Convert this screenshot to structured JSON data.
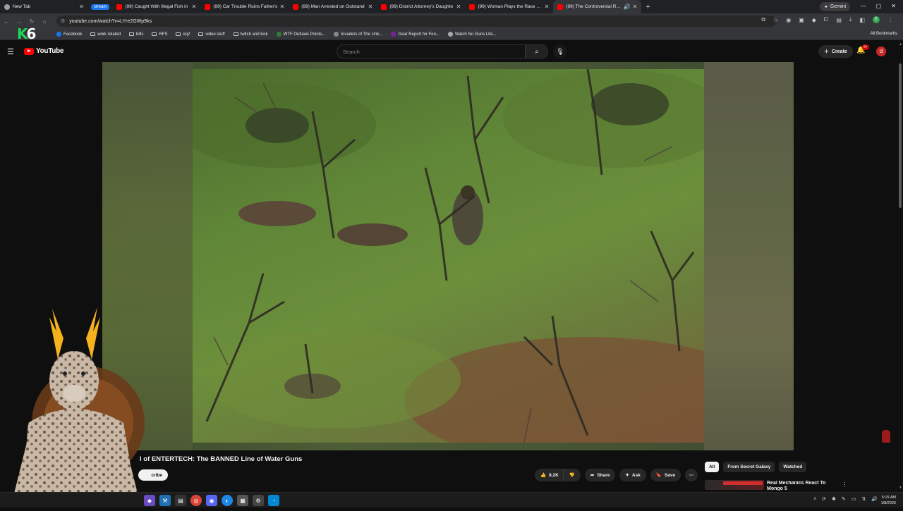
{
  "browser": {
    "tabs": [
      {
        "title": "New Tab",
        "icon": "chrome-icon",
        "active": false
      },
      {
        "title": "(99) Caught With Illegal Fish in",
        "icon": "youtube-icon",
        "active": false
      },
      {
        "title": "(99) Car Trouble Ruins Father's",
        "icon": "youtube-icon",
        "active": false
      },
      {
        "title": "(99) Man Arrested on Outstand",
        "icon": "youtube-icon",
        "active": false
      },
      {
        "title": "(99) District Attorney's Daughte",
        "icon": "youtube-icon",
        "active": false
      },
      {
        "title": "(99) Woman Plays the Race Car",
        "icon": "youtube-icon",
        "active": false
      },
      {
        "title": "(99) The Controversial Rise",
        "icon": "youtube-icon",
        "active": true
      }
    ],
    "tab_group_label": "stream",
    "gemini_label": "Gemini",
    "url": "youtube.com/watch?v=LYre2GWp9ks",
    "bookmarks": [
      "Facebook",
      "work related",
      "bills",
      "RFS",
      "eq2",
      "video stuff",
      "twitch and kick",
      "WTF Outlaws Points...",
      "Invaders of The Unk...",
      "Gear Report for Fen...",
      "Watch No Guns Life..."
    ],
    "all_bookmarks_label": "All Bookmarks",
    "overlay_logo": {
      "letter": "K",
      "digit": "6"
    }
  },
  "youtube": {
    "logo_text": "YouTube",
    "search_placeholder": "Search",
    "create_label": "Create",
    "notification_count": "9+",
    "avatar_letter": "d",
    "video_title": "l of ENTERTECH: The BANNED Line of Water Guns",
    "subscribe_label": "cribe",
    "likes": "8.2K",
    "share_label": "Share",
    "ask_label": "Ask",
    "save_label": "Save",
    "chips": [
      "All",
      "From Secret Galaxy",
      "Watched"
    ],
    "recommendation_title": "Real Mechanics React To Mongo 5"
  },
  "taskbar": {
    "time": "5:15 AM",
    "date": "1/8/2026"
  },
  "colors": {
    "yt_red": "#ff0000",
    "k6_green": "#1fd655",
    "chip_active_bg": "#f1f1f1"
  }
}
